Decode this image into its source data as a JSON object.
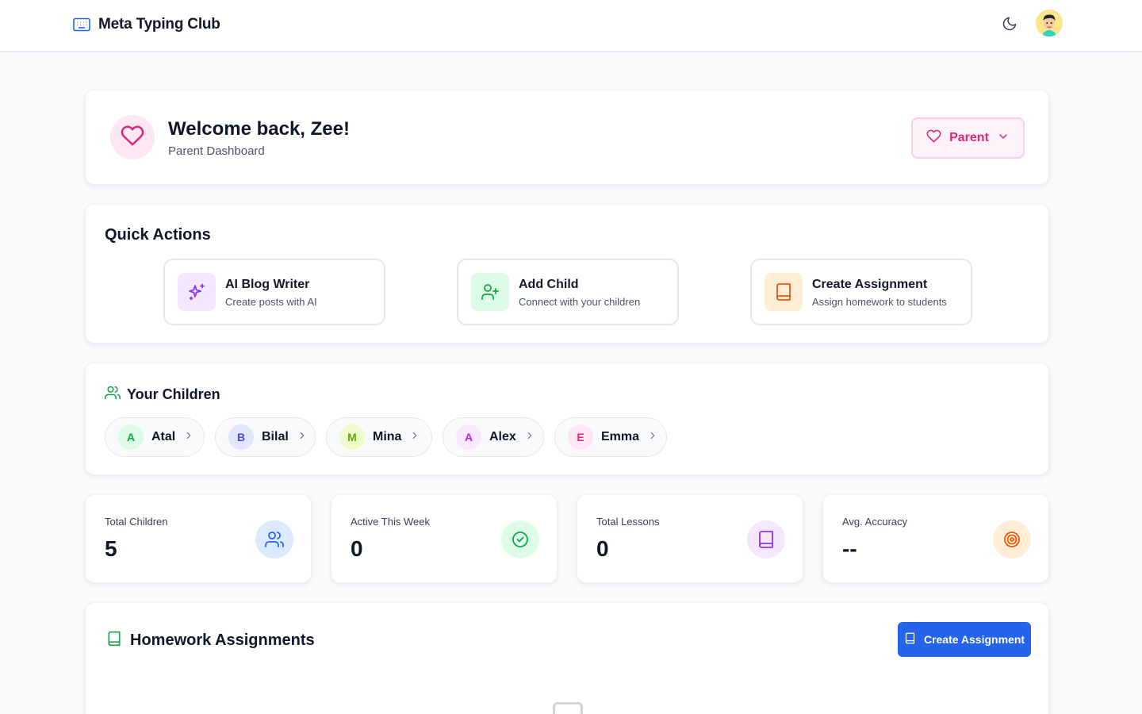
{
  "header": {
    "brand": "Meta Typing Club",
    "icons": {
      "brand": "keyboard-icon",
      "theme": "moon-icon",
      "avatar": "user-avatar"
    }
  },
  "welcome": {
    "title": "Welcome back, Zee!",
    "subtitle": "Parent Dashboard",
    "role_label": "Parent",
    "accent": "#db2777"
  },
  "quick_actions": {
    "title": "Quick Actions",
    "items": [
      {
        "title": "AI Blog Writer",
        "subtitle": "Create posts with AI",
        "icon": "sparkles-icon"
      },
      {
        "title": "Add Child",
        "subtitle": "Connect with your children",
        "icon": "user-plus-icon"
      },
      {
        "title": "Create Assignment",
        "subtitle": "Assign homework to students",
        "icon": "book-icon"
      }
    ]
  },
  "children": {
    "title": "Your Children",
    "items": [
      {
        "initial": "A",
        "name": "Atal"
      },
      {
        "initial": "B",
        "name": "Bilal"
      },
      {
        "initial": "M",
        "name": "Mina"
      },
      {
        "initial": "A",
        "name": "Alex"
      },
      {
        "initial": "E",
        "name": "Emma"
      }
    ]
  },
  "stats": [
    {
      "label": "Total Children",
      "value": "5",
      "icon": "users-icon"
    },
    {
      "label": "Active This Week",
      "value": "0",
      "icon": "check-circle-icon"
    },
    {
      "label": "Total Lessons",
      "value": "0",
      "icon": "book-icon"
    },
    {
      "label": "Avg. Accuracy",
      "value": "--",
      "icon": "target-icon"
    }
  ],
  "homework": {
    "title": "Homework Assignments",
    "create_label": "Create Assignment"
  }
}
